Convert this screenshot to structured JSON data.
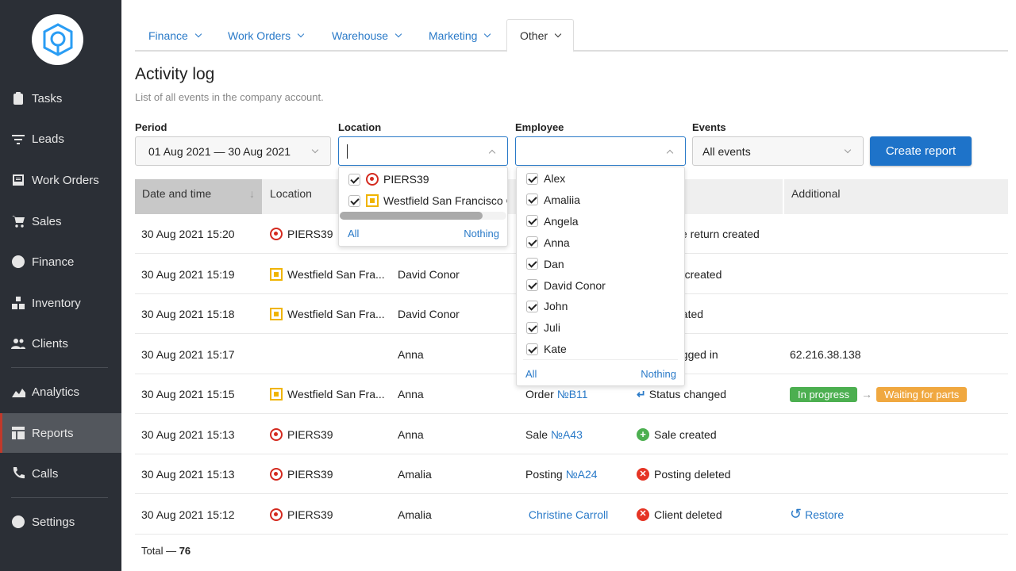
{
  "sidebar": {
    "items": [
      {
        "label": "Tasks",
        "icon": "clipboard-icon"
      },
      {
        "label": "Leads",
        "icon": "filter-icon"
      },
      {
        "label": "Work Orders",
        "icon": "inbox-icon"
      },
      {
        "label": "Sales",
        "icon": "cart-icon"
      },
      {
        "label": "Finance",
        "icon": "dollar-icon"
      },
      {
        "label": "Inventory",
        "icon": "boxes-icon"
      },
      {
        "label": "Clients",
        "icon": "users-icon"
      },
      {
        "label": "Analytics",
        "icon": "chart-icon"
      },
      {
        "label": "Reports",
        "icon": "table-icon",
        "active": true
      },
      {
        "label": "Calls",
        "icon": "phone-icon"
      },
      {
        "label": "Settings",
        "icon": "gear-icon"
      }
    ]
  },
  "tabs": [
    {
      "label": "Finance"
    },
    {
      "label": "Work Orders"
    },
    {
      "label": "Warehouse"
    },
    {
      "label": "Marketing"
    },
    {
      "label": "Other",
      "active": true
    }
  ],
  "page": {
    "title": "Activity log",
    "subtitle": "List of all events in the company account."
  },
  "filters": {
    "period": {
      "label": "Period",
      "value": "01 Aug 2021 — 30 Aug 2021"
    },
    "location": {
      "label": "Location",
      "value": ""
    },
    "employee": {
      "label": "Employee",
      "value": ""
    },
    "events": {
      "label": "Events",
      "value": "All events"
    },
    "create_report": "Create report"
  },
  "location_dropdown": {
    "options": [
      "PIERS39",
      "Westfield San Francisco Ce"
    ],
    "all": "All",
    "nothing": "Nothing"
  },
  "employee_dropdown": {
    "options": [
      "Alex",
      "Amaliia",
      "Angela",
      "Anna",
      "Dan",
      "David Conor",
      "John",
      "Juli",
      "Kate"
    ],
    "all": "All",
    "nothing": "Nothing"
  },
  "table": {
    "headers": {
      "date": "Date and time",
      "location": "Location",
      "additional": "Additional"
    },
    "rows": [
      {
        "date": "30 Aug 2021 15:20",
        "location": "PIERS39",
        "loc_type": "red",
        "employee": "",
        "object": "",
        "object_link": "",
        "event": "se return created",
        "event_icon": "",
        "additional": ""
      },
      {
        "date": "30 Aug 2021 15:19",
        "location": "Westfield San Fra...",
        "loc_type": "yellow",
        "employee": "David Conor",
        "object": "",
        "object_link": "",
        "event": "g created",
        "event_icon": "",
        "additional": ""
      },
      {
        "date": "30 Aug 2021 15:18",
        "location": "Westfield San Fra...",
        "loc_type": "yellow",
        "employee": "David Conor",
        "object": "",
        "object_link": "",
        "event": "eated",
        "event_icon": "",
        "additional": ""
      },
      {
        "date": "30 Aug 2021 15:17",
        "location": "",
        "loc_type": "",
        "employee": "Anna",
        "object": "",
        "object_link": "",
        "event": "ogged in",
        "event_icon": "",
        "additional": "62.216.38.138"
      },
      {
        "date": "30 Aug 2021 15:15",
        "location": "Westfield San Fra...",
        "loc_type": "yellow",
        "employee": "Anna",
        "object": "Order ",
        "object_link": "№B11",
        "event": "Status changed",
        "event_icon": "status",
        "badges": {
          "from": "In progress",
          "to": "Waiting for parts"
        }
      },
      {
        "date": "30 Aug 2021 15:13",
        "location": "PIERS39",
        "loc_type": "red",
        "employee": "Anna",
        "object": "Sale ",
        "object_link": "№A43",
        "event": "Sale created",
        "event_icon": "plus",
        "additional": ""
      },
      {
        "date": "30 Aug 2021 15:13",
        "location": "PIERS39",
        "loc_type": "red",
        "employee": "Amalia",
        "object": "Posting ",
        "object_link": "№A24",
        "event": "Posting deleted",
        "event_icon": "x",
        "additional": ""
      },
      {
        "date": "30 Aug 2021 15:12",
        "location": "PIERS39",
        "loc_type": "red",
        "employee": "Amalia",
        "object": "",
        "object_link": "Christine Carroll",
        "event": "Client deleted",
        "event_icon": "x",
        "restore": "Restore"
      }
    ]
  },
  "total": {
    "label": "Total — ",
    "value": "76"
  },
  "colors": {
    "sidebar": "#2b2f36",
    "accent": "#1e73c9",
    "green": "#4caf50",
    "orange": "#f0a840",
    "red": "#e53424"
  }
}
